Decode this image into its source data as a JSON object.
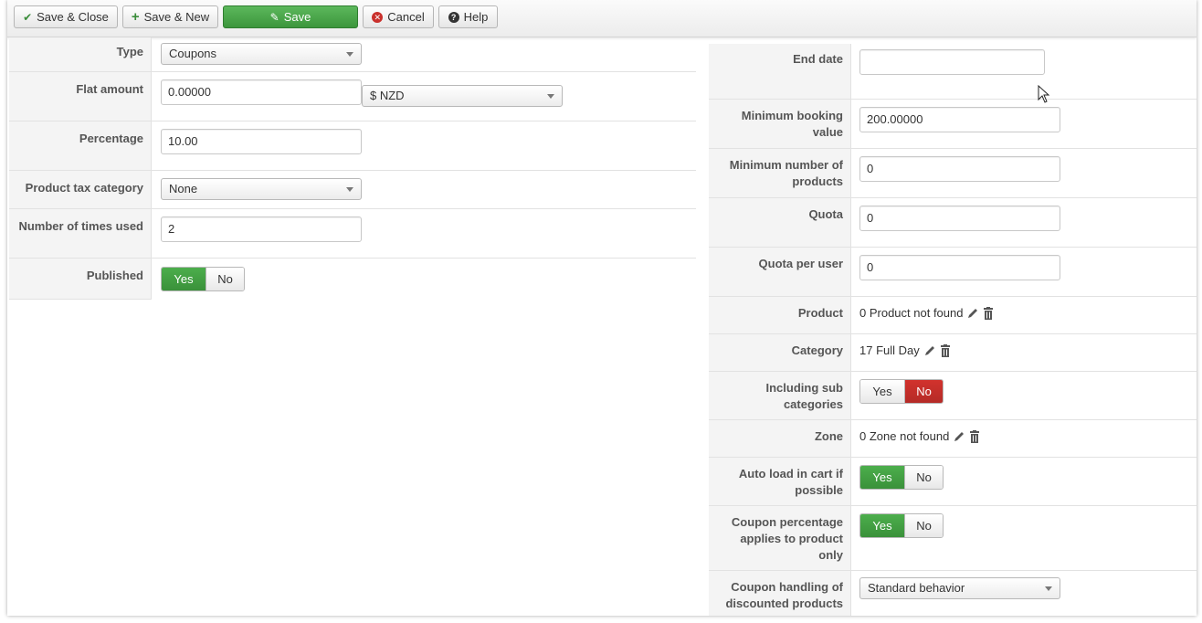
{
  "toolbar": {
    "save_close": "Save & Close",
    "save_new": "Save & New",
    "save": "Save",
    "cancel": "Cancel",
    "help": "Help"
  },
  "left": {
    "type": {
      "label": "Type",
      "value": "Coupons"
    },
    "flat_amount": {
      "label": "Flat amount",
      "value": "0.00000",
      "currency": "$ NZD"
    },
    "percentage": {
      "label": "Percentage",
      "value": "10.00"
    },
    "product_tax_category": {
      "label": "Product tax category",
      "value": "None"
    },
    "times_used": {
      "label": "Number of times used",
      "value": "2"
    },
    "published": {
      "label": "Published",
      "yes": "Yes",
      "no": "No",
      "selected": "Yes"
    }
  },
  "right": {
    "end_date": {
      "label": "End date",
      "value": ""
    },
    "min_booking": {
      "label": "Minimum booking value",
      "value": "200.00000"
    },
    "min_products": {
      "label": "Minimum number of products",
      "value": "0"
    },
    "quota": {
      "label": "Quota",
      "value": "0"
    },
    "quota_per_user": {
      "label": "Quota per user",
      "value": "0"
    },
    "product": {
      "label": "Product",
      "value": "0 Product not found"
    },
    "category": {
      "label": "Category",
      "value": "17 Full Day"
    },
    "including_sub": {
      "label": "Including sub categories",
      "yes": "Yes",
      "no": "No",
      "selected": "No"
    },
    "zone": {
      "label": "Zone",
      "value": "0 Zone not found"
    },
    "auto_load": {
      "label": "Auto load in cart if possible",
      "yes": "Yes",
      "no": "No",
      "selected": "Yes"
    },
    "coupon_pct": {
      "label": "Coupon percentage applies to product only",
      "yes": "Yes",
      "no": "No",
      "selected": "Yes"
    },
    "coupon_handling": {
      "label": "Coupon handling of discounted products",
      "value": "Standard behavior"
    }
  },
  "colors": {
    "green": "#47a447",
    "red": "#c9302c"
  },
  "icons": [
    "check-icon",
    "plus-icon",
    "edit-icon",
    "cancel-icon",
    "help-icon",
    "calendar-icon",
    "pencil-icon",
    "trash-icon",
    "mouse-cursor-icon"
  ]
}
